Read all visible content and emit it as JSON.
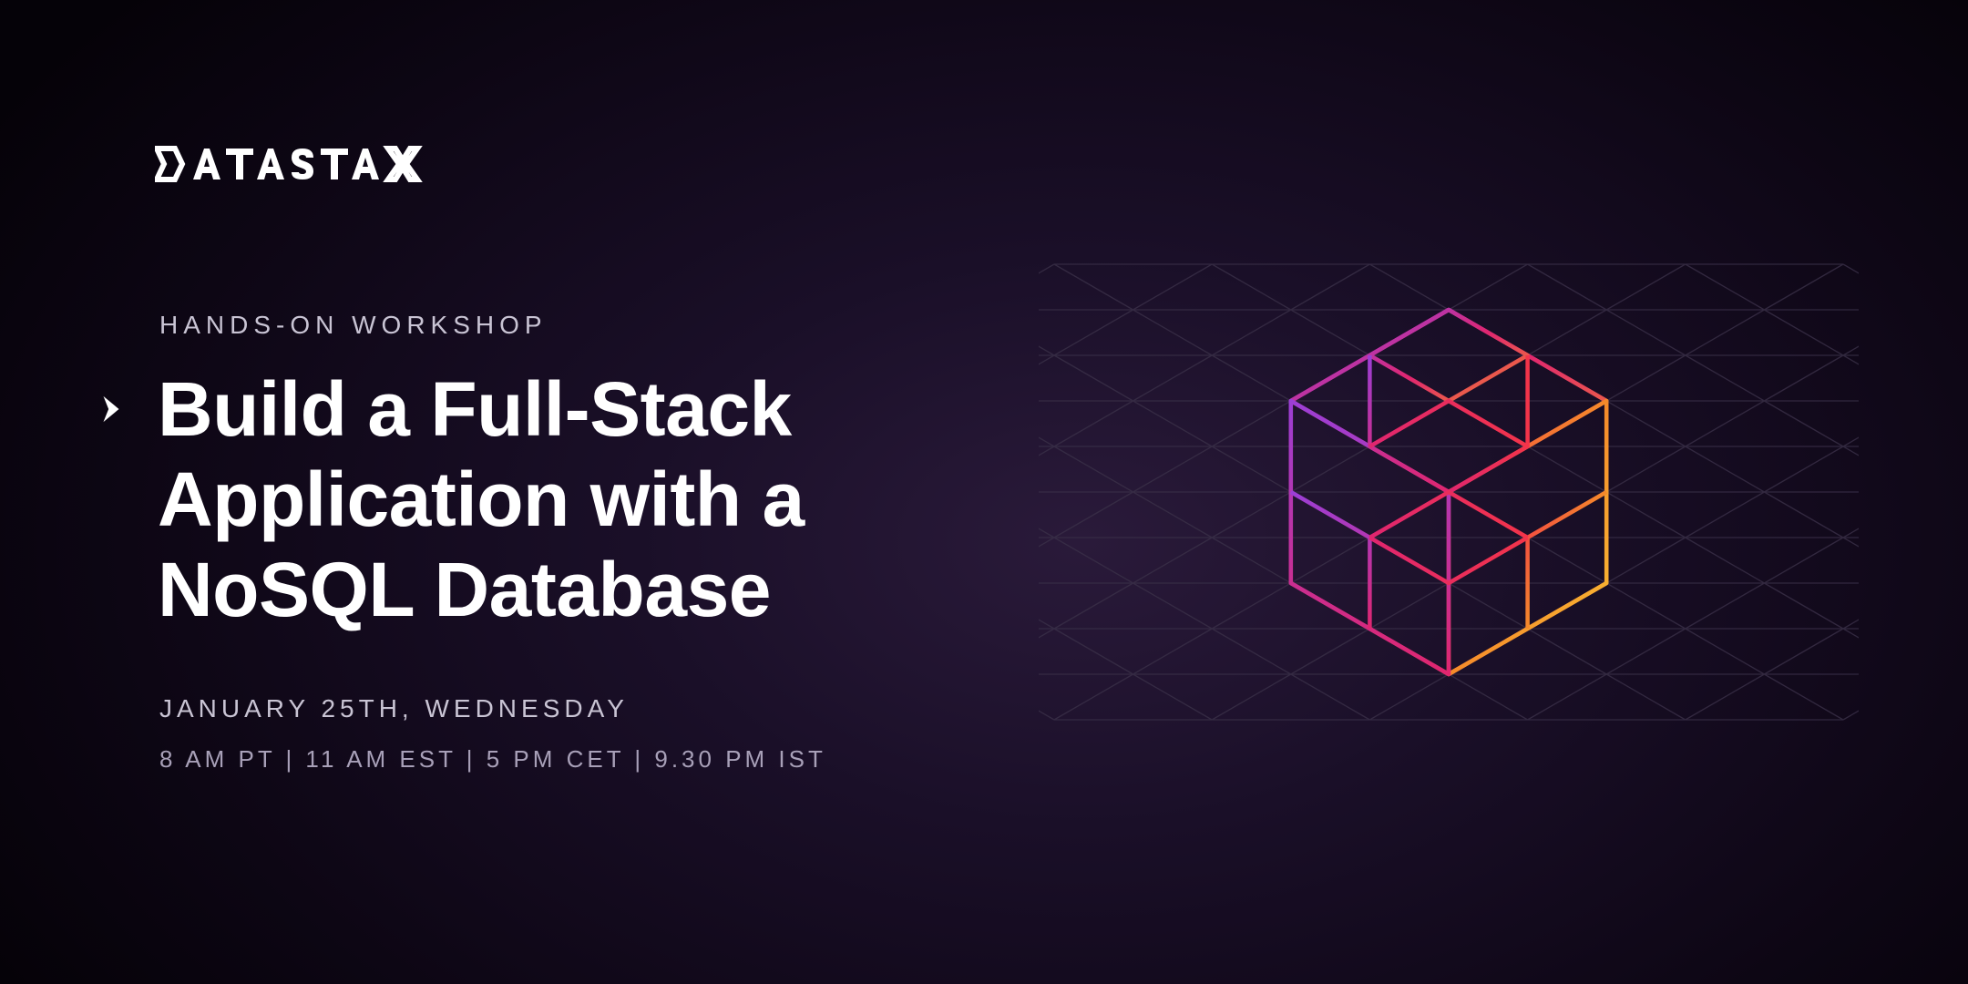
{
  "brand": "DATASTAX",
  "eyebrow": "HANDS-ON WORKSHOP",
  "title_line1": "Build a Full-Stack",
  "title_line2": "Application with a",
  "title_line3": "NoSQL Database",
  "date": "JANUARY 25TH, WEDNESDAY",
  "times": "8 AM PT  |  11 AM EST  |  5 PM CET  |  9.30 PM IST",
  "colors": {
    "purple": "#9b3fd6",
    "magenta": "#e0266f",
    "red": "#f3344a",
    "orange": "#f58a2a",
    "yellow": "#f9c233",
    "grid": "#3a3048"
  }
}
